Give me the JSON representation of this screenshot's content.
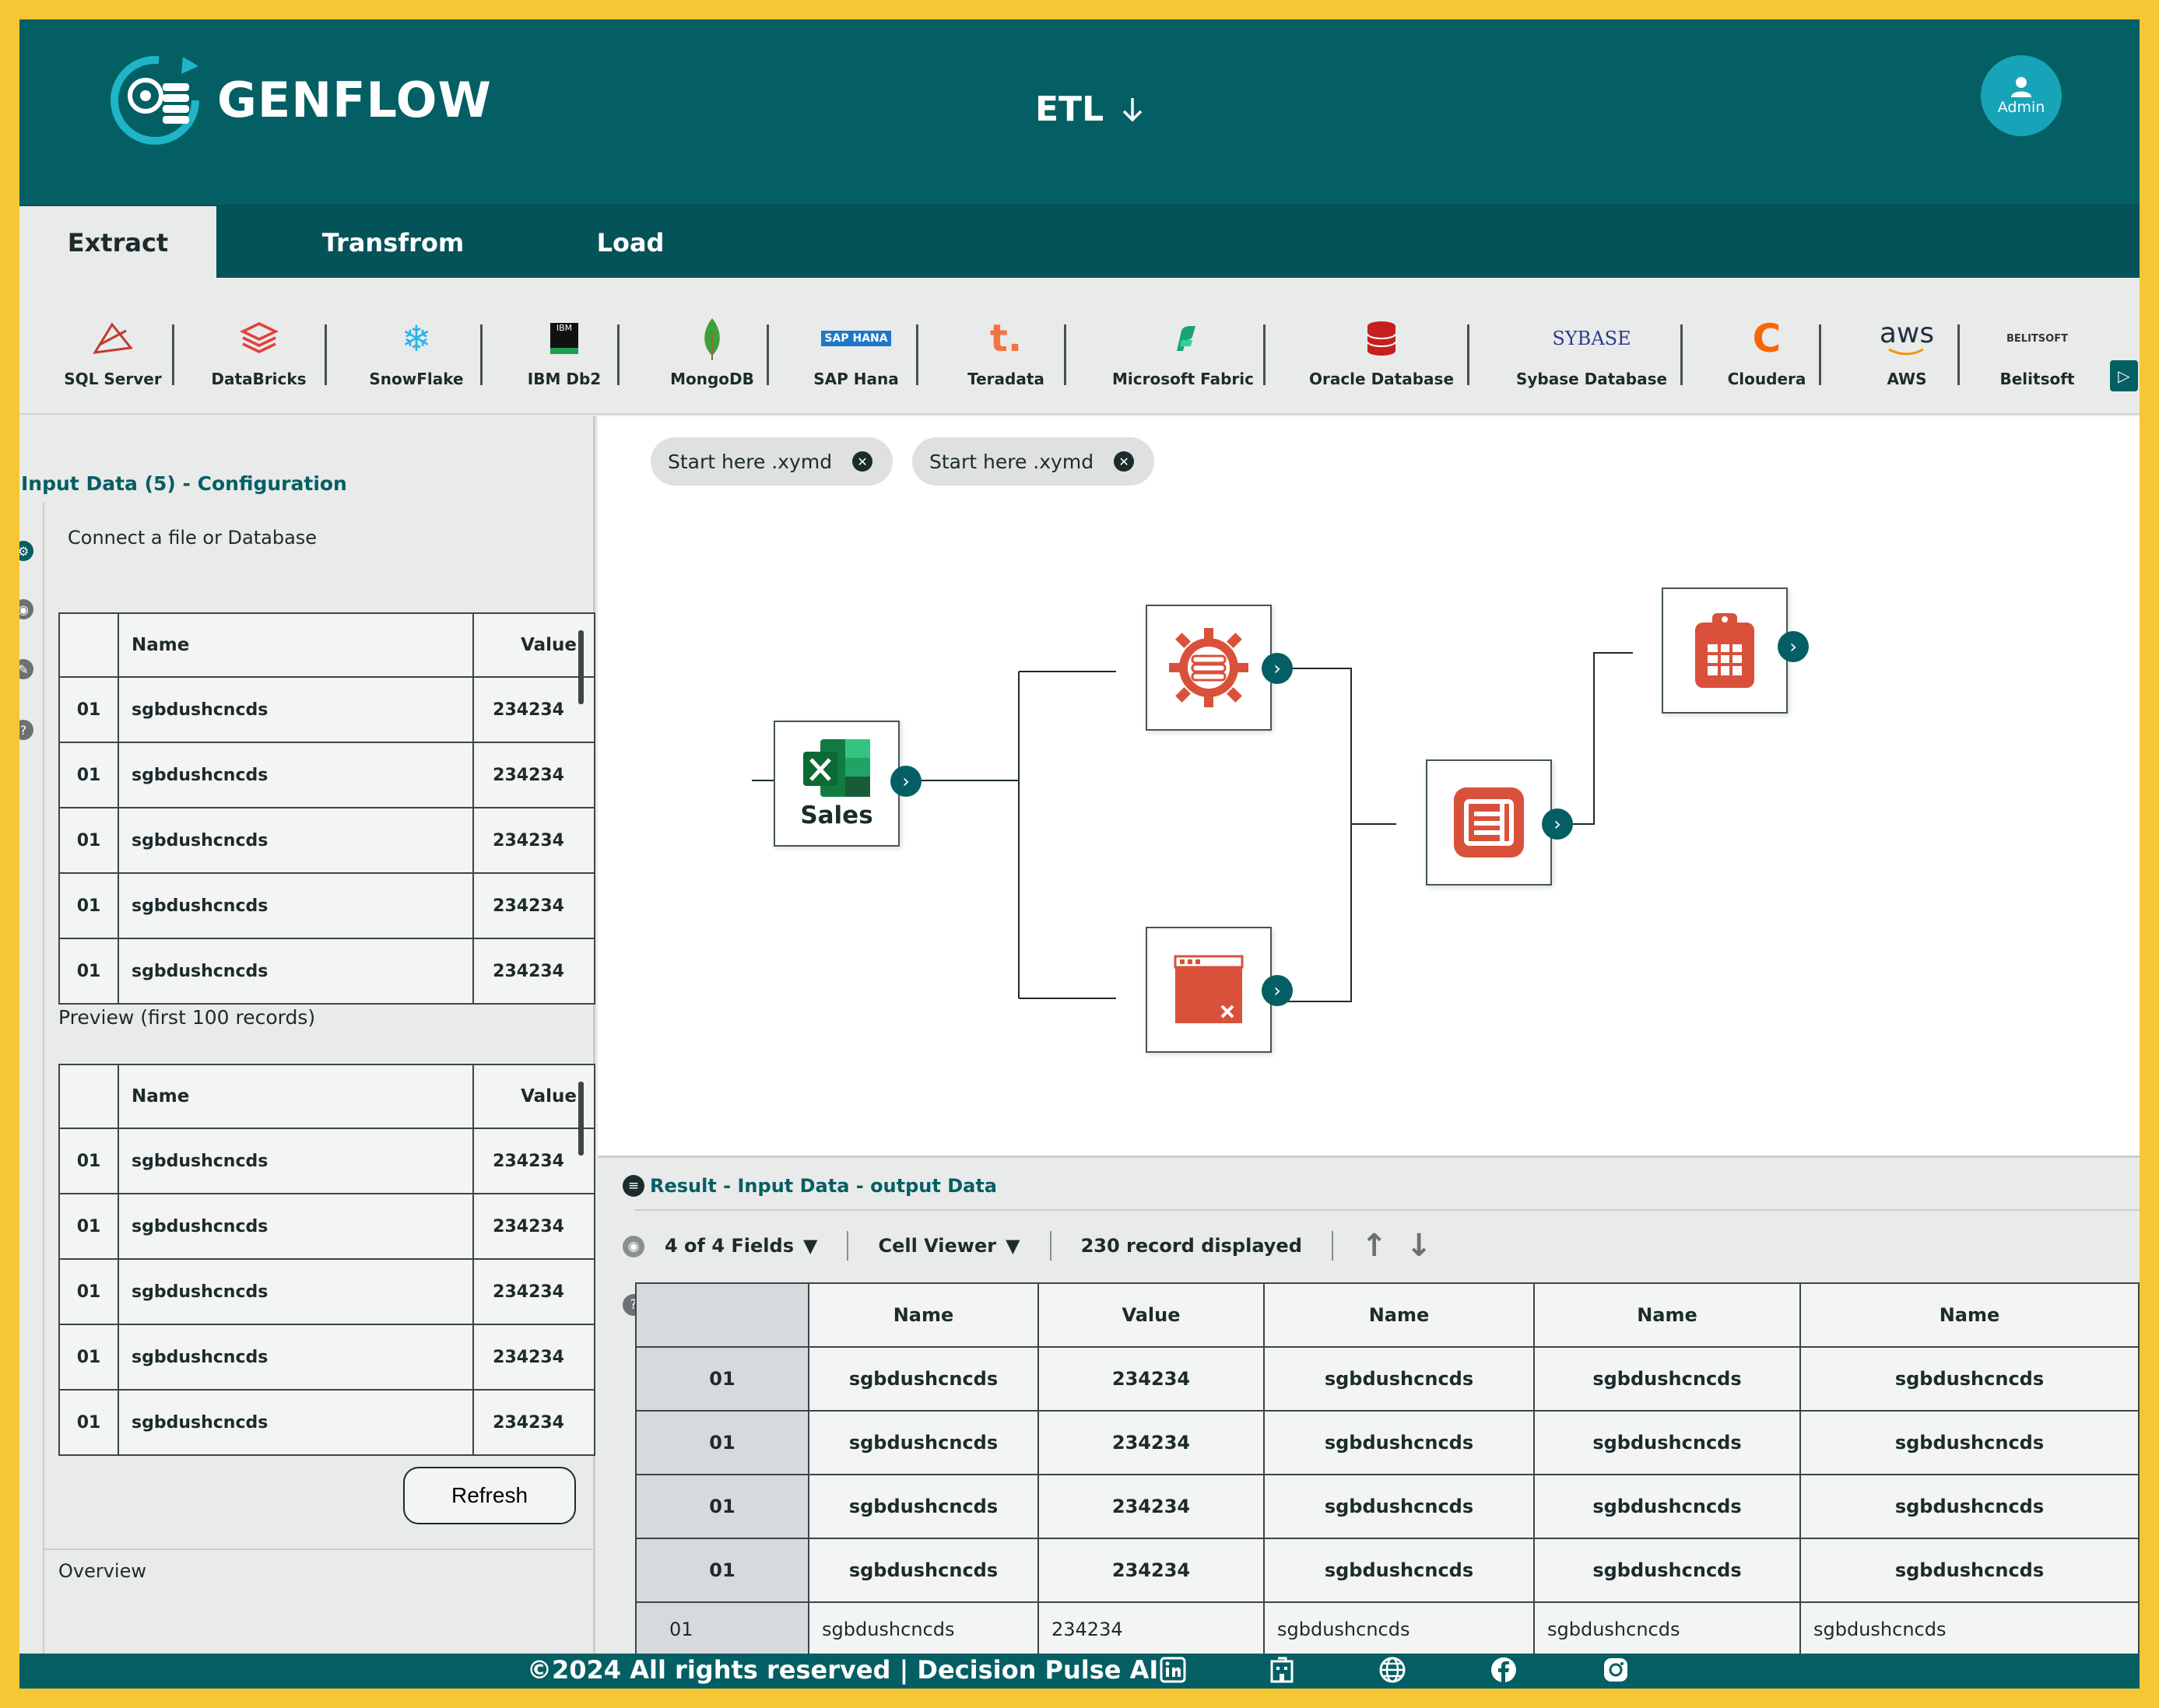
{
  "app": {
    "brand": "GENFLOW",
    "module": "ETL",
    "user": "Admin",
    "colors": {
      "brand": "#035f63",
      "accent": "#f7c635",
      "node_icon": "#d9513a"
    }
  },
  "tabs": [
    {
      "label": "Extract",
      "active": true
    },
    {
      "label": "Transfrom",
      "active": false
    },
    {
      "label": "Load",
      "active": false
    }
  ],
  "connectors": [
    {
      "label": "SQL Server",
      "icon": "sql-server-icon"
    },
    {
      "label": "DataBricks",
      "icon": "databricks-icon"
    },
    {
      "label": "SnowFlake",
      "icon": "snowflake-icon"
    },
    {
      "label": "IBM Db2",
      "icon": "ibm-db2-icon",
      "icon_text": "IBM"
    },
    {
      "label": "MongoDB",
      "icon": "mongodb-leaf-icon"
    },
    {
      "label": "SAP Hana",
      "icon": "sap-hana-icon",
      "icon_text": "SAP HANA"
    },
    {
      "label": "Teradata",
      "icon": "teradata-icon",
      "icon_text": "t."
    },
    {
      "label": "Microsoft Fabric",
      "icon": "microsoft-fabric-icon"
    },
    {
      "label": "Oracle Database",
      "icon": "oracle-database-icon"
    },
    {
      "label": "Sybase Database",
      "icon": "sybase-icon",
      "icon_text": "SYBASE"
    },
    {
      "label": "Cloudera",
      "icon": "cloudera-icon",
      "icon_text": "C"
    },
    {
      "label": "AWS",
      "icon": "aws-icon",
      "icon_text": "aws"
    },
    {
      "label": "Belitsoft",
      "icon": "belitsoft-icon",
      "icon_text": "BELITSOFT"
    }
  ],
  "input_panel": {
    "title": "Input Data (5) - Configuration",
    "connect_label": "Connect a file or Database",
    "columns": [
      "Name",
      "Value"
    ],
    "rows": [
      [
        "01",
        "sgbdushcncds",
        "234234"
      ],
      [
        "01",
        "sgbdushcncds",
        "234234"
      ],
      [
        "01",
        "sgbdushcncds",
        "234234"
      ],
      [
        "01",
        "sgbdushcncds",
        "234234"
      ],
      [
        "01",
        "sgbdushcncds",
        "234234"
      ]
    ],
    "preview_label": "Preview (first 100 records)",
    "preview_columns": [
      "Name",
      "Value"
    ],
    "preview_rows": [
      [
        "01",
        "sgbdushcncds",
        "234234"
      ],
      [
        "01",
        "sgbdushcncds",
        "234234"
      ],
      [
        "01",
        "sgbdushcncds",
        "234234"
      ],
      [
        "01",
        "sgbdushcncds",
        "234234"
      ],
      [
        "01",
        "sgbdushcncds",
        "234234"
      ]
    ],
    "refresh_label": "Refresh",
    "overview_label": "Overview"
  },
  "canvas": {
    "file_tabs": [
      "Start here .xymd",
      "Start here .xymd"
    ],
    "nodes": [
      {
        "id": "sales",
        "label": "Sales",
        "icon": "excel-icon"
      },
      {
        "id": "configure",
        "icon": "gear-database-icon"
      },
      {
        "id": "filter",
        "icon": "window-close-icon"
      },
      {
        "id": "summarize",
        "icon": "document-list-icon"
      },
      {
        "id": "output",
        "icon": "clipboard-table-icon"
      }
    ]
  },
  "result": {
    "title": "Result -  Input Data - output Data",
    "fields_label": "4 of 4 Fields",
    "viewer_label": "Cell Viewer",
    "records_label": "230 record displayed",
    "columns": [
      "Name",
      "Value",
      "Name",
      "Name",
      "Name"
    ],
    "rows": [
      [
        "01",
        "sgbdushcncds",
        "234234",
        "sgbdushcncds",
        "sgbdushcncds",
        "sgbdushcncds"
      ],
      [
        "01",
        "sgbdushcncds",
        "234234",
        "sgbdushcncds",
        "sgbdushcncds",
        "sgbdushcncds"
      ],
      [
        "01",
        "sgbdushcncds",
        "234234",
        "sgbdushcncds",
        "sgbdushcncds",
        "sgbdushcncds"
      ],
      [
        "01",
        "sgbdushcncds",
        "234234",
        "sgbdushcncds",
        "sgbdushcncds",
        "sgbdushcncds"
      ],
      [
        "01",
        "sgbdushcncds",
        "234234",
        "sgbdushcncds",
        "sgbdushcncds",
        "sgbdushcncds"
      ]
    ]
  },
  "footer": {
    "text": "©2024 All rights reserved | Decision Pulse AI",
    "icons": [
      "linkedin-icon",
      "building-icon",
      "globe-icon",
      "facebook-icon",
      "instagram-icon"
    ]
  }
}
